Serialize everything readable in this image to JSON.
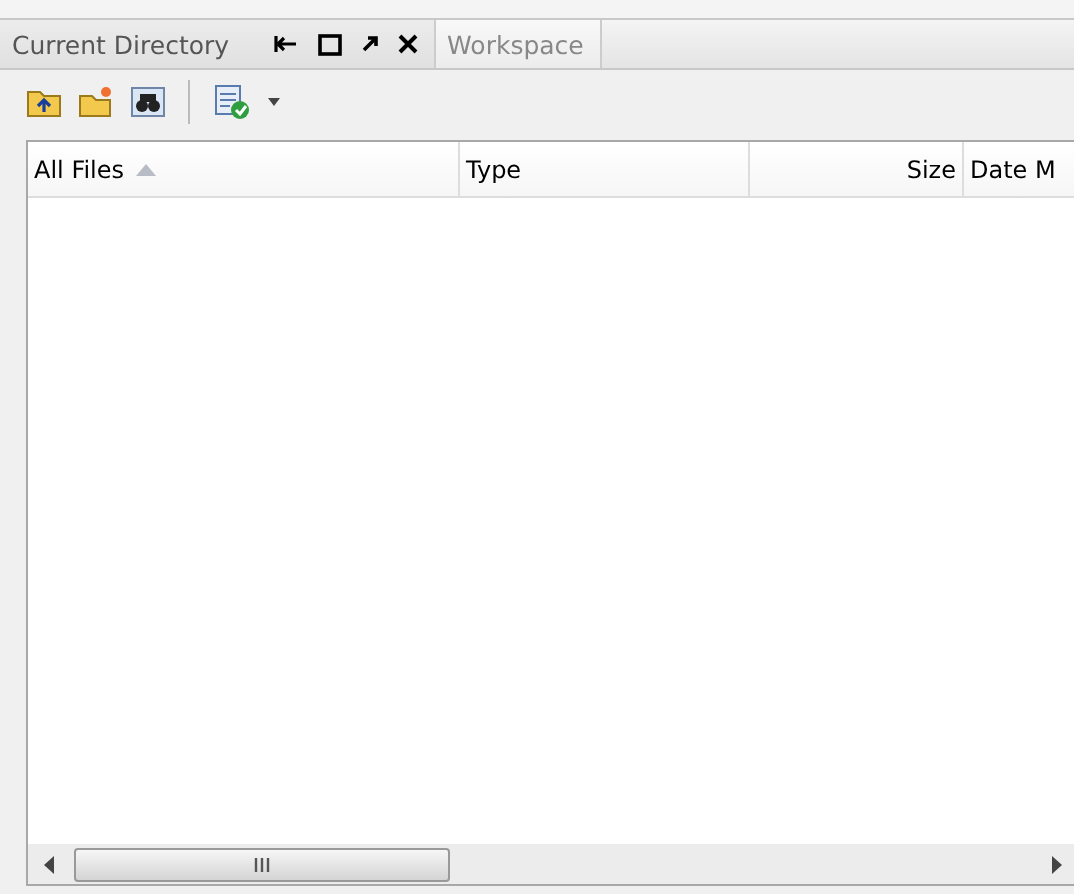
{
  "tabs": [
    {
      "label": "Current Directory",
      "selected": true
    },
    {
      "label": "Workspace",
      "selected": false
    }
  ],
  "toolbar": {
    "has_dropdown": true
  },
  "table": {
    "columns": [
      {
        "label": "All Files",
        "kind": "text",
        "sorted": true
      },
      {
        "label": "Type",
        "kind": "text",
        "sorted": false
      },
      {
        "label": "Size",
        "kind": "number",
        "sorted": false
      },
      {
        "label": "Date M",
        "kind": "text",
        "sorted": false
      }
    ]
  }
}
